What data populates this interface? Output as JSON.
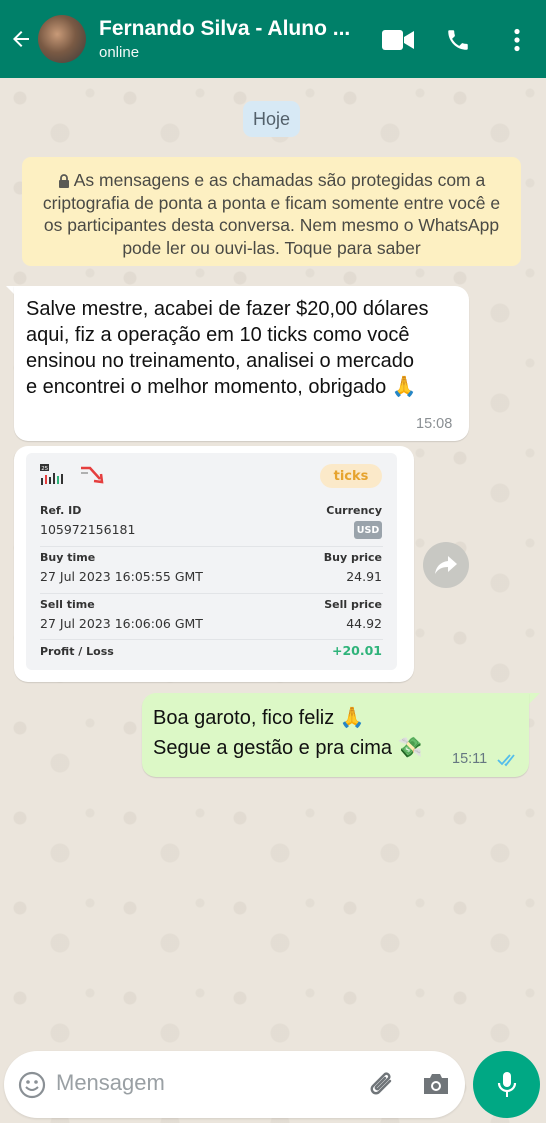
{
  "header": {
    "contact_name": "Fernando Silva  - Aluno ...",
    "status": "online",
    "icons": [
      "back-arrow-icon",
      "video-call-icon",
      "phone-icon",
      "more-vert-icon"
    ],
    "color": "#008069"
  },
  "date_chip": "Hoje",
  "encryption_notice": "As mensagens e as chamadas são protegidas com a criptografia de ponta a ponta e ficam somente entre você e os participantes desta conversa. Nem mesmo o WhatsApp pode ler ou ouvi-las. Toque para saber",
  "messages": [
    {
      "direction": "incoming",
      "lines": [
        "Salve mestre, acabei de fazer $20,00 dólares",
        "aqui, fiz a operação em 10 ticks como você",
        "ensinou no treinamento, analisei o mercado",
        "e encontrei o melhor momento, obrigado 🙏"
      ],
      "time": "15:08"
    },
    {
      "direction": "incoming",
      "type": "image",
      "receipt": {
        "logo_number": "25",
        "badge": "ticks",
        "ref_id_label": "Ref. ID",
        "ref_id": "105972156181",
        "currency_label": "Currency",
        "currency": "USD",
        "buy_time_label": "Buy time",
        "buy_time": "27 Jul 2023 16:05:55 GMT",
        "buy_price_label": "Buy price",
        "buy_price": "24.91",
        "sell_time_label": "Sell time",
        "sell_time": "27 Jul 2023 16:06:06 GMT",
        "sell_price_label": "Sell price",
        "sell_price": "44.92",
        "profit_label": "Profit / Loss",
        "profit": "+20.01"
      }
    },
    {
      "direction": "outgoing",
      "lines": [
        "Boa garoto, fico feliz 🙏",
        "Segue a gestão e pra cima 💸"
      ],
      "time": "15:11",
      "read_status": "read"
    }
  ],
  "input": {
    "placeholder": "Mensagem",
    "icons": [
      "emoji-icon",
      "attach-icon",
      "camera-icon",
      "mic-icon"
    ]
  },
  "colors": {
    "accent": "#008069",
    "outgoing_bubble": "#dcf8c6",
    "notice_bg": "#fdf0c2",
    "profit": "#2fb37a",
    "read_ticks": "#53bdeb",
    "mic_button": "#00a884"
  }
}
